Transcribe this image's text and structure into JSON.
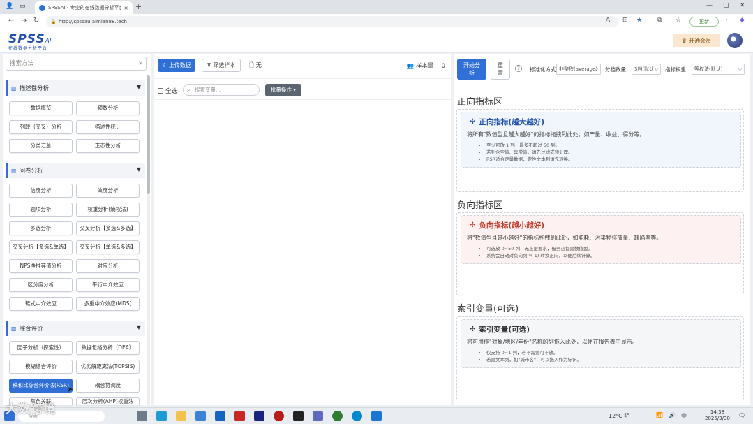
{
  "browser": {
    "tab_title": "SPSSAI - 专业的在线数据分析平台",
    "tab_close": "×",
    "new_tab": "+",
    "url": "http://spssau.aimian88.tech",
    "update_label": "更新"
  },
  "app": {
    "logo_text": "SPSS",
    "logo_ai": "AI",
    "logo_sub": "在线数据分析平台",
    "vip_label": "开通会员"
  },
  "left": {
    "search_placeholder": "搜索方法",
    "search_clear": "×",
    "sections": [
      {
        "title": "描述性分析",
        "items": [
          "数据概览",
          "频数分析",
          "列联（交叉）分析",
          "描述性统计",
          "分类汇总",
          "正态性分析"
        ]
      },
      {
        "title": "问卷分析",
        "items": [
          "信度分析",
          "效度分析",
          "题项分析",
          "权重分析(熵权法)",
          "多选分析",
          "交叉分析【多选&多选】",
          "交叉分析【多选&单选】",
          "交叉分析【单选&多选】",
          "NPS净推荐值分析",
          "对应分析",
          "区分度分析",
          "平行中介效应",
          "链式中介效应",
          "多重中介效应(MDS)"
        ]
      },
      {
        "title": "综合评价",
        "items": [
          "因子分析（探索性）",
          "数据包络分析（DEA）",
          "模糊综合评价",
          "优劣解距离法(TOPSIS)",
          "秩和比综合评价法(RSR)",
          "耦合协调度",
          "灰色关联",
          "层次分析(AHP)权重法"
        ]
      }
    ]
  },
  "mid": {
    "upload_label": "上传数据",
    "filter_label": "筛选样本",
    "file_label": "无",
    "sample_label": "样本量：",
    "sample_value": "0",
    "select_all": "全选",
    "var_search_placeholder": "搜索变量...",
    "batch_label": "批量操作"
  },
  "right": {
    "start_label": "开始分析",
    "reset_label": "重置",
    "method_label": "标准化方式",
    "method_value": "非整秩(average)",
    "grade_label": "分档数量",
    "grade_value": "3档(默认)",
    "weight_label": "指标权重",
    "weight_value": "等权法(默认)",
    "zones": [
      {
        "title": "正向指标区",
        "card_title": "正向指标(越大越好)",
        "desc": "将所有\"数值型且越大越好\"的指标拖拽到此处，如产量、收益、得分等。",
        "bullets": [
          "至少可放 1 列，最多不超过 50 列。",
          "若列含空值、异常值，请先过滤或预处理。",
          "RSR适合定量数据，定性文本列请先转换。"
        ]
      },
      {
        "title": "负向指标区",
        "card_title": "负向指标(越小越好)",
        "desc": "将\"数值型且越小越好\"的指标拖拽到此处，如能耗、污染物排放量、缺陷率等。",
        "bullets": [
          "可选放 0~50 列，无上限要求，但务必都是数值型。",
          "系统会自动对负向列 *(-1) 转换正向，以便后续计算。"
        ]
      },
      {
        "title": "索引变量(可选)",
        "card_title": "索引变量(可选)",
        "desc": "将可用作\"对象/地区/年份\"名称的列拖入此处，以便在报告表中显示。",
        "bullets": [
          "仅支持 0~1 列，若不需要可不放。",
          "若是文本列，如\"城市名\"，可以拖入作为标识。"
        ]
      }
    ]
  },
  "taskbar": {
    "watermark": "大数跨境",
    "search_placeholder": "搜索",
    "weather": "12°C 阴",
    "ime": "中",
    "time": "14:38",
    "date": "2025/3/30"
  },
  "colors": {
    "primary": "#2f6fd6",
    "positive_title": "#1f4fa8",
    "negative_title": "#c0392b",
    "neutral_title": "#333333"
  }
}
